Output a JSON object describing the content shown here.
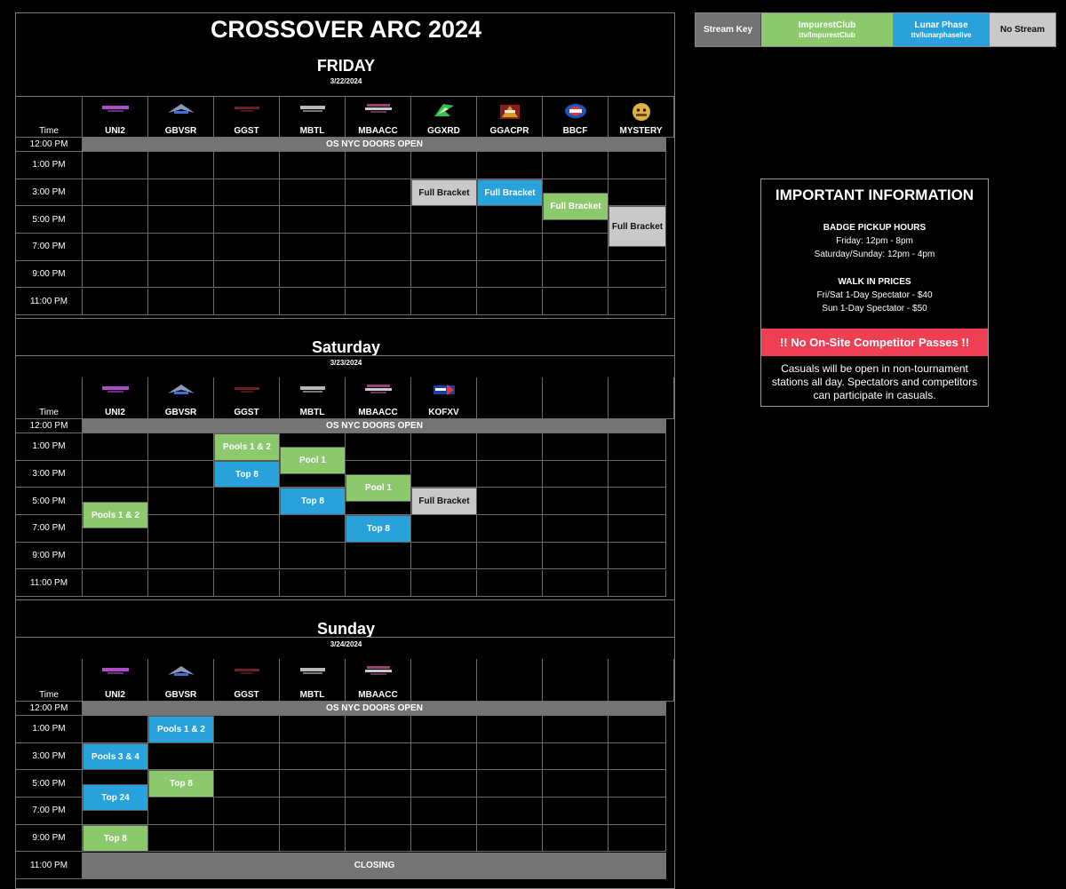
{
  "title": "CROSSOVER ARC 2024",
  "time_header": "Time",
  "days": [
    {
      "name": "FRIDAY",
      "date": "3/22/2024",
      "games": [
        "UNI2",
        "GBVSR",
        "GGST",
        "MBTL",
        "MBAACC",
        "GGXRD",
        "GGACPR",
        "BBCF",
        "MYSTERY"
      ],
      "band_time": "12:00 PM",
      "band_text": "OS NYC DOORS OPEN",
      "times": [
        "1:00 PM",
        "3:00 PM",
        "5:00 PM",
        "7:00 PM",
        "9:00 PM",
        "11:00 PM"
      ],
      "events": [
        {
          "col": 5,
          "start": 3,
          "span": 2,
          "label": "Full Bracket",
          "stream": "none"
        },
        {
          "col": 6,
          "start": 3,
          "span": 2,
          "label": "Full Bracket",
          "stream": "lunar"
        },
        {
          "col": 7,
          "start": 4,
          "span": 2,
          "label": "Full Bracket",
          "stream": "impurest"
        },
        {
          "col": 8,
          "start": 5,
          "span": 3,
          "label": "Full Bracket",
          "stream": "none"
        }
      ]
    },
    {
      "name": "Saturday",
      "date": "3/23/2024",
      "games": [
        "UNI2",
        "GBVSR",
        "GGST",
        "MBTL",
        "MBAACC",
        "KOFXV",
        "",
        "",
        ""
      ],
      "band_time": "12:00 PM",
      "band_text": "OS NYC DOORS OPEN",
      "times": [
        "1:00 PM",
        "3:00 PM",
        "5:00 PM",
        "7:00 PM",
        "9:00 PM",
        "11:00 PM"
      ],
      "events": [
        {
          "col": 2,
          "start": 1,
          "span": 2,
          "label": "Pools 1 & 2",
          "stream": "impurest"
        },
        {
          "col": 3,
          "start": 2,
          "span": 2,
          "label": "Pool 1",
          "stream": "impurest"
        },
        {
          "col": 2,
          "start": 3,
          "span": 2,
          "label": "Top 8",
          "stream": "lunar"
        },
        {
          "col": 4,
          "start": 4,
          "span": 2,
          "label": "Pool 1",
          "stream": "impurest"
        },
        {
          "col": 3,
          "start": 5,
          "span": 2,
          "label": "Top 8",
          "stream": "lunar"
        },
        {
          "col": 5,
          "start": 5,
          "span": 2,
          "label": "Full Bracket",
          "stream": "none"
        },
        {
          "col": 0,
          "start": 6,
          "span": 2,
          "label": "Pools 1 & 2",
          "stream": "impurest"
        },
        {
          "col": 4,
          "start": 7,
          "span": 2,
          "label": "Top 8",
          "stream": "lunar"
        }
      ]
    },
    {
      "name": "Sunday",
      "date": "3/24/2024",
      "games": [
        "UNI2",
        "GBVSR",
        "GGST",
        "MBTL",
        "MBAACC",
        "",
        "",
        "",
        ""
      ],
      "band_time": "12:00 PM",
      "band_text": "OS NYC DOORS OPEN",
      "times": [
        "1:00 PM",
        "3:00 PM",
        "5:00 PM",
        "7:00 PM",
        "9:00 PM"
      ],
      "closing_time": "11:00 PM",
      "closing_text": "CLOSING",
      "events": [
        {
          "col": 1,
          "start": 1,
          "span": 2,
          "label": "Pools 1 & 2",
          "stream": "lunar"
        },
        {
          "col": 0,
          "start": 3,
          "span": 2,
          "label": "Pools 3 & 4",
          "stream": "lunar"
        },
        {
          "col": 1,
          "start": 5,
          "span": 2,
          "label": "Top 8",
          "stream": "impurest"
        },
        {
          "col": 0,
          "start": 6,
          "span": 2,
          "label": "Top 24",
          "stream": "lunar"
        },
        {
          "col": 0,
          "start": 9,
          "span": 2,
          "label": "Top 8",
          "stream": "impurest"
        }
      ]
    }
  ],
  "stream_key": {
    "label": "Stream Key",
    "impurest": {
      "name": "ImpurestClub",
      "handle": "ttv/ImpurestClub"
    },
    "lunar": {
      "name": "Lunar Phase",
      "handle": "ttv/lunarphaselive"
    },
    "none": {
      "name": "No Stream"
    }
  },
  "info": {
    "heading": "IMPORTANT INFORMATION",
    "badge_heading": "BADGE PICKUP HOURS",
    "badge_lines": [
      "Friday: 12pm - 8pm",
      "Saturday/Sunday: 12pm - 4pm"
    ],
    "walkin_heading": "WALK IN PRICES",
    "walkin_lines": [
      "Fri/Sat 1-Day Spectator - $40",
      "Sun 1-Day Spectator - $50"
    ],
    "warning": "!! No On-Site Competitor Passes  !!",
    "casuals": "Casuals will be open in non-tournament stations all day. Spectators and competitors can participate in casuals."
  },
  "colors": {
    "impurest": "#8bc96c",
    "lunar": "#29a2dc",
    "none": "#c9c9c9",
    "band": "#747474",
    "warning": "#f03e55"
  },
  "game_logo_icons": {
    "UNI2": "uni2-logo-icon",
    "GBVSR": "gbvsr-logo-icon",
    "GGST": "ggst-logo-icon",
    "MBTL": "mbtl-logo-icon",
    "MBAACC": "mbaacc-logo-icon",
    "GGXRD": "ggxrd-logo-icon",
    "GGACPR": "ggacpr-logo-icon",
    "BBCF": "bbcf-logo-icon",
    "MYSTERY": "mystery-face-icon",
    "KOFXV": "kofxv-logo-icon"
  }
}
